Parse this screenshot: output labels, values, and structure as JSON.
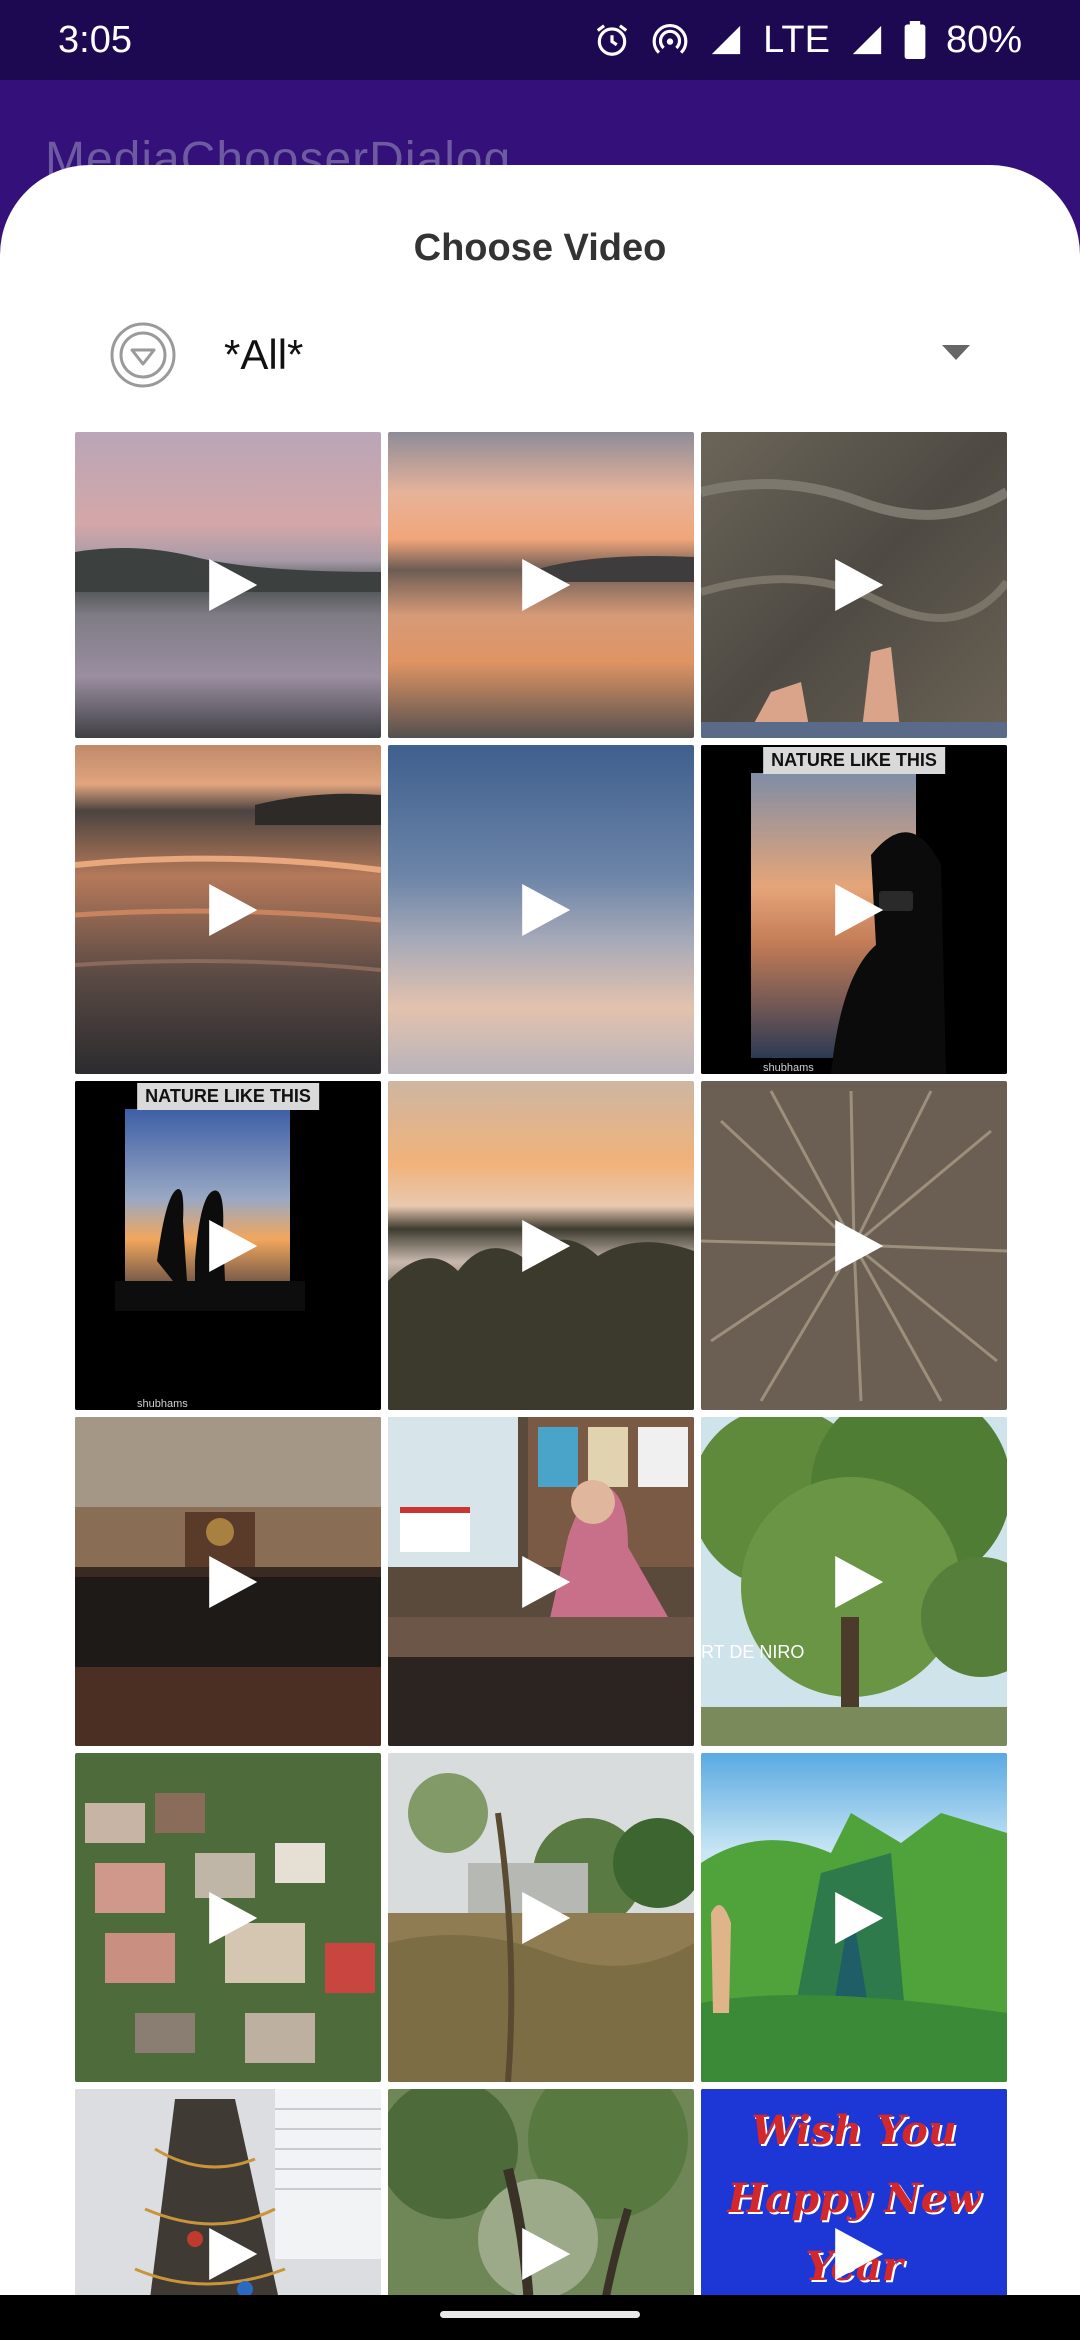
{
  "status_bar": {
    "time": "3:05",
    "network": "LTE",
    "battery": "80%",
    "icons": [
      "alarm-icon",
      "hotspot-icon",
      "signal-icon",
      "battery-icon"
    ]
  },
  "app_bar": {
    "title": "MediaChooserDialog"
  },
  "dialog": {
    "title": "Choose Video",
    "folder_selector": {
      "icon": "folder-filter-icon",
      "selected": "*All*",
      "arrow_icon": "dropdown-arrow-icon"
    }
  },
  "videos": [
    {
      "id": "lake-dawn-reflection"
    },
    {
      "id": "orange-sunset-water"
    },
    {
      "id": "feet-in-water"
    },
    {
      "id": "ripple-sunset"
    },
    {
      "id": "blue-sky-dusk"
    },
    {
      "id": "nature-phone-silhouette",
      "caption": "NATURE LIKE THIS",
      "credit": "shubhams"
    },
    {
      "id": "nature-couple-silhouette",
      "caption": "NATURE LIKE THIS",
      "credit": "shubhams"
    },
    {
      "id": "sunset-over-river-bushes"
    },
    {
      "id": "dry-grass-closeup"
    },
    {
      "id": "courtroom"
    },
    {
      "id": "teacher-classroom"
    },
    {
      "id": "green-trees",
      "overlay_text": "RT DE NIRO"
    },
    {
      "id": "aerial-town"
    },
    {
      "id": "field-trees"
    },
    {
      "id": "green-cliffs-painting"
    },
    {
      "id": "cable-tree"
    },
    {
      "id": "forest-trees"
    },
    {
      "id": "wish-new-year",
      "lines": [
        "Wish You",
        "Happy New",
        "Year"
      ]
    }
  ],
  "colors": {
    "status_bar": "#1d0852",
    "app_bar": "#33107a",
    "dialog_bg": "#ffffff",
    "title_text": "#333333"
  }
}
